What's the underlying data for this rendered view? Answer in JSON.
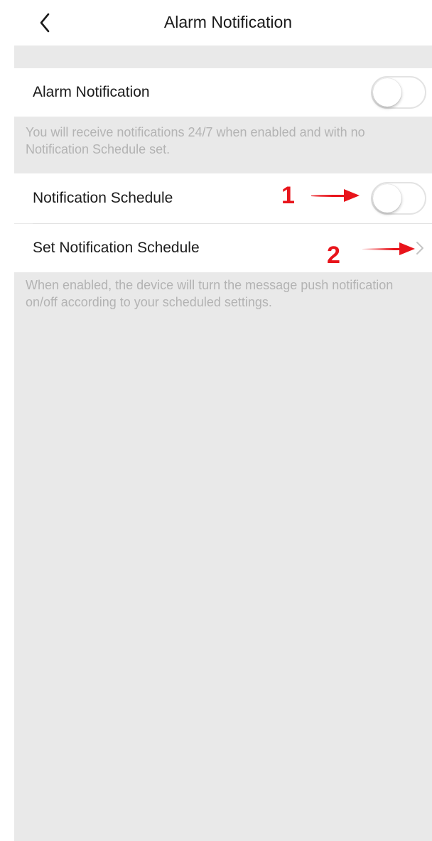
{
  "header": {
    "title": "Alarm Notification",
    "back_icon": "chevron-left-icon"
  },
  "alarm_notification": {
    "label": "Alarm Notification",
    "enabled": false,
    "note": "You will receive notifications 24/7 when enabled and with no Notification Schedule set."
  },
  "notification_schedule": {
    "label": "Notification Schedule",
    "enabled": false
  },
  "set_schedule": {
    "label": "Set Notification Schedule",
    "icon": "chevron-right-icon"
  },
  "schedule_note": "When enabled, the device will turn the message push notification on/off according to your scheduled settings.",
  "annotations": {
    "one": "1",
    "two": "2",
    "color": "#e8141b"
  },
  "colors": {
    "background": "#e9e9e9",
    "row": "#ffffff",
    "note_text": "#b3b3b3",
    "toggle_border": "#e3e3e3"
  }
}
